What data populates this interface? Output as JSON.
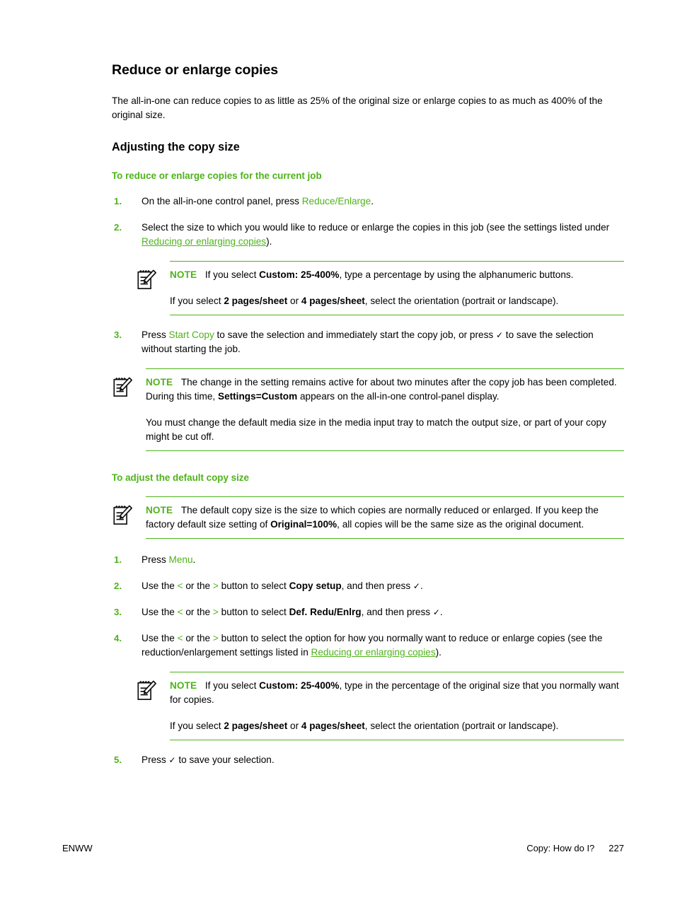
{
  "page": {
    "title": "Reduce or enlarge copies",
    "intro": "The all-in-one can reduce copies to as little as 25% of the original size or enlarge copies to as much as 400% of the original size.",
    "section_title": "Adjusting the copy size"
  },
  "colors": {
    "accent_green": "#4EB31A",
    "text_black": "#000000",
    "page_background": "#FFFFFF"
  },
  "icons": {
    "note_icon": "notepad-pencil-icon",
    "check_glyph": "✓",
    "left_arrow_glyph": "<",
    "right_arrow_glyph": ">"
  },
  "procedure_1": {
    "heading": "To reduce or enlarge copies for the current job",
    "steps": [
      {
        "num": "1.",
        "text_before": "On the all-in-one control panel, press ",
        "ui_term": "Reduce/Enlarge",
        "text_after": "."
      },
      {
        "num": "2.",
        "text_before": "Select the size to which you would like to reduce or enlarge the copies in this job (see the settings listed under ",
        "link": "Reducing or enlarging copies",
        "text_after": ")."
      },
      {
        "num": "3.",
        "text_before": "Press ",
        "ui_term": "Start Copy",
        "text_mid": " to save the selection and immediately start the copy job, or press ",
        "check": "✓",
        "text_after": " to save the selection without starting the job."
      }
    ],
    "note_1": {
      "label": "NOTE",
      "para1_a": "If you select ",
      "para1_bold": "Custom: 25-400%",
      "para1_b": ", type a percentage by using the alphanumeric buttons.",
      "para2_a": "If you select ",
      "para2_bold1": "2 pages/sheet",
      "para2_mid": " or ",
      "para2_bold2": "4 pages/sheet",
      "para2_b": ", select the orientation (portrait or landscape)."
    },
    "note_2": {
      "label": "NOTE",
      "para1_a": "The change in the setting remains active for about two minutes after the copy job has been completed. During this time, ",
      "para1_bold": "Settings=Custom",
      "para1_b": " appears on the all-in-one control-panel display.",
      "para2": "You must change the default media size in the media input tray to match the output size, or part of your copy might be cut off."
    }
  },
  "procedure_2": {
    "heading": "To adjust the default copy size",
    "note_1": {
      "label": "NOTE",
      "para1_a": "The default copy size is the size to which copies are normally reduced or enlarged. If you keep the factory default size setting of ",
      "para1_bold": "Original=100%",
      "para1_b": ", all copies will be the same size as the original document."
    },
    "steps": [
      {
        "num": "1.",
        "text_before": "Press ",
        "ui_term": "Menu",
        "text_after": "."
      },
      {
        "num": "2.",
        "text_before": "Use the ",
        "arrow_left": "<",
        "text_mid1": " or the ",
        "arrow_right": ">",
        "text_mid2": " button to select ",
        "bold": "Copy setup",
        "text_mid3": ", and then press ",
        "check": "✓",
        "text_after": "."
      },
      {
        "num": "3.",
        "text_before": "Use the ",
        "arrow_left": "<",
        "text_mid1": " or the ",
        "arrow_right": ">",
        "text_mid2": " button to select ",
        "bold": "Def. Redu/Enlrg",
        "text_mid3": ", and then press ",
        "check": "✓",
        "text_after": "."
      },
      {
        "num": "4.",
        "text_before": "Use the ",
        "arrow_left": "<",
        "text_mid1": " or the ",
        "arrow_right": ">",
        "text_mid2": " button to select the option for how you normally want to reduce or enlarge copies (see the reduction/enlargement settings listed in ",
        "link": "Reducing or enlarging copies",
        "text_after": ")."
      },
      {
        "num": "5.",
        "text_before": "Press ",
        "check": "✓",
        "text_after": " to save your selection."
      }
    ],
    "note_2": {
      "label": "NOTE",
      "para1_a": "If you select ",
      "para1_bold": "Custom: 25-400%",
      "para1_b": ", type in the percentage of the original size that you normally want for copies.",
      "para2_a": "If you select ",
      "para2_bold1": "2 pages/sheet",
      "para2_mid": " or ",
      "para2_bold2": "4 pages/sheet",
      "para2_b": ", select the orientation (portrait or landscape)."
    }
  },
  "footer": {
    "left": "ENWW",
    "chapter": "Copy: How do I?",
    "page_number": "227"
  }
}
